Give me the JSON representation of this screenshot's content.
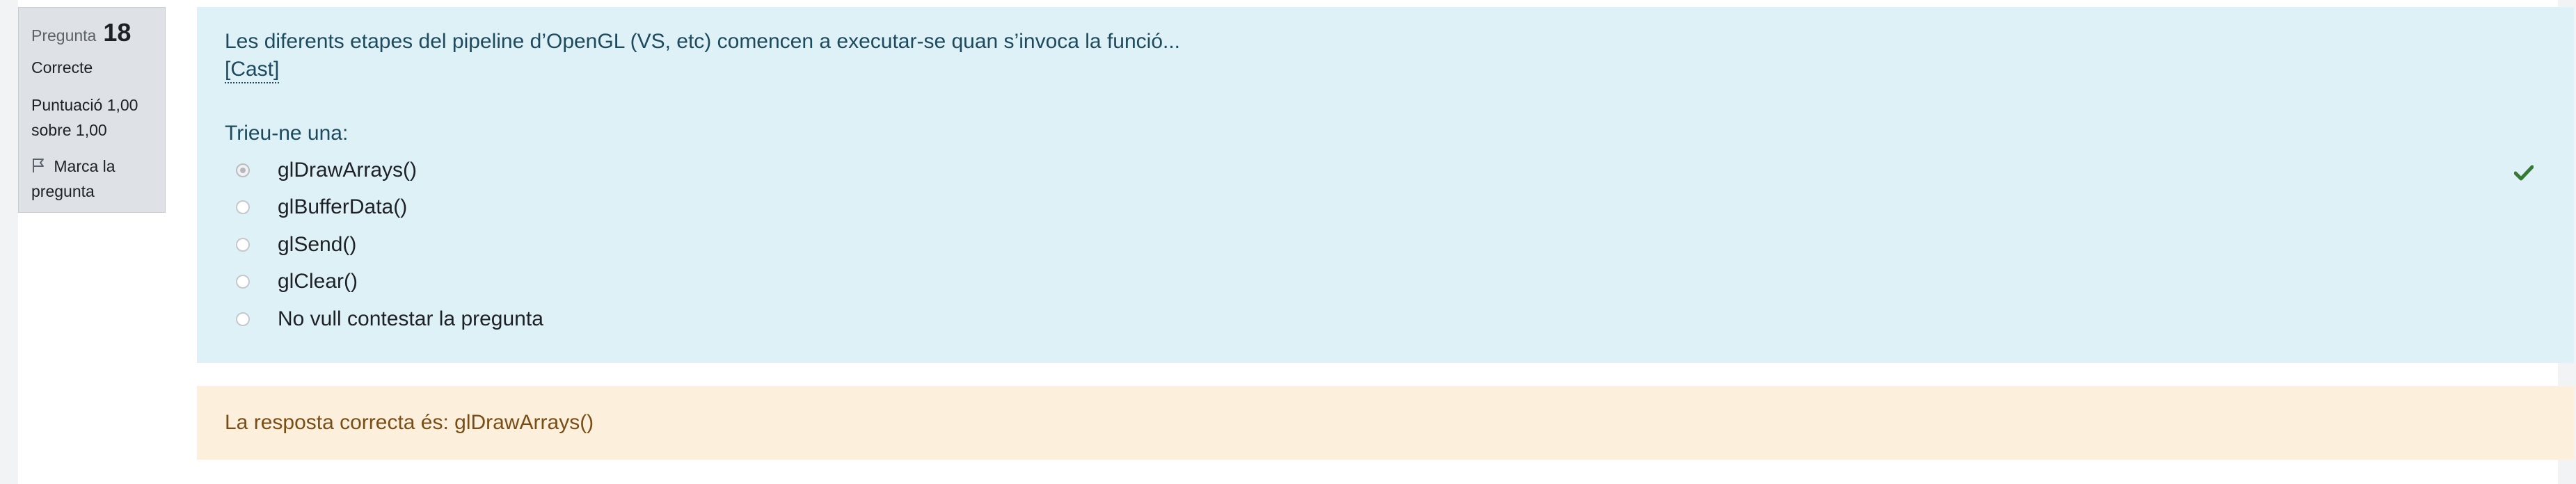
{
  "info": {
    "question_label": "Pregunta",
    "question_number": "18",
    "state": "Correcte",
    "grade_line1": "Puntuació 1,00",
    "grade_line2": "sobre 1,00",
    "flag_line1": "Marca la",
    "flag_line2": "pregunta"
  },
  "question": {
    "text": "Les diferents etapes del pipeline d’OpenGL (VS, etc) comencen a executar-se quan s’invoca la funció...",
    "link_text": "[Cast]",
    "prompt": "Trieu-ne una:",
    "answers": [
      {
        "label": "glDrawArrays()",
        "selected": true
      },
      {
        "label": "glBufferData()",
        "selected": false
      },
      {
        "label": "glSend()",
        "selected": false
      },
      {
        "label": "glClear()",
        "selected": false
      },
      {
        "label": "No vull contestar la pregunta",
        "selected": false
      }
    ]
  },
  "feedback": {
    "text": "La resposta correcta és: glDrawArrays()"
  },
  "colors": {
    "info_bg": "#dee2e6",
    "formulation_bg": "#def1f7",
    "feedback_bg": "#fcefdc",
    "correct_green": "#357a32"
  },
  "icons": {
    "flag": "flag-icon",
    "correct": "check-icon"
  }
}
